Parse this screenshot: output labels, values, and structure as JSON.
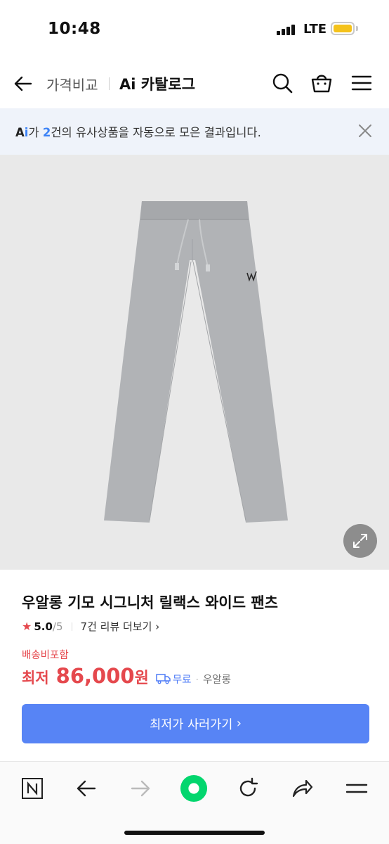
{
  "status_bar": {
    "time": "10:48",
    "network": "LTE"
  },
  "header": {
    "breadcrumb_price": "가격비교",
    "breadcrumb_catalog": "Ai 카탈로그"
  },
  "banner": {
    "ai_a": "A",
    "ai_i": "i",
    "text_before": "가 ",
    "count": "2",
    "text_after": "건의 유사상품을 자동으로 모은 결과입니다."
  },
  "product": {
    "title": "우알롱 기모 시그니처 릴랙스 와이드 팬츠",
    "rating": "5.0",
    "rating_max": "/5",
    "review_link": "7건 리뷰 더보기",
    "shipping_included": "배송비포함",
    "lowest_label": "최저",
    "price": "86,000",
    "currency": "원",
    "shipping": "무료",
    "seller": "우알롱"
  },
  "cta": {
    "label": "최저가 사러가기"
  },
  "colors": {
    "accent_blue": "#5784f5",
    "price_red": "#e5484d",
    "banner_bg": "#eff3fa"
  }
}
